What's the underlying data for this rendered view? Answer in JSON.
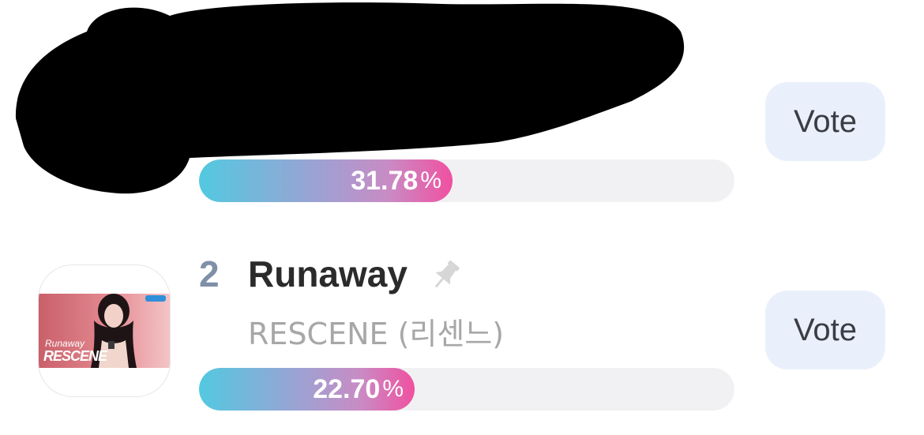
{
  "entries": [
    {
      "rank": "",
      "title": "",
      "artist": "",
      "percent_value": "31.78",
      "percent_sign": "%",
      "progress": 0.4779,
      "vote_label": "Vote",
      "redacted": true
    },
    {
      "rank": "2",
      "title": "Runaway",
      "artist": "RESCENE (리센느)",
      "percent_value": "22.70",
      "percent_sign": "%",
      "progress": 0.4036,
      "vote_label": "Vote",
      "pin_icon": "pin-icon",
      "thumbnail": {
        "overlay_line1": "Runaway",
        "overlay_line2": "RESCENE"
      }
    }
  ],
  "colors": {
    "bar_start": "#52c9e0",
    "bar_end": "#f050a0",
    "vote_bg": "#eaf0fb",
    "rank_color": "#7f8fa8"
  }
}
